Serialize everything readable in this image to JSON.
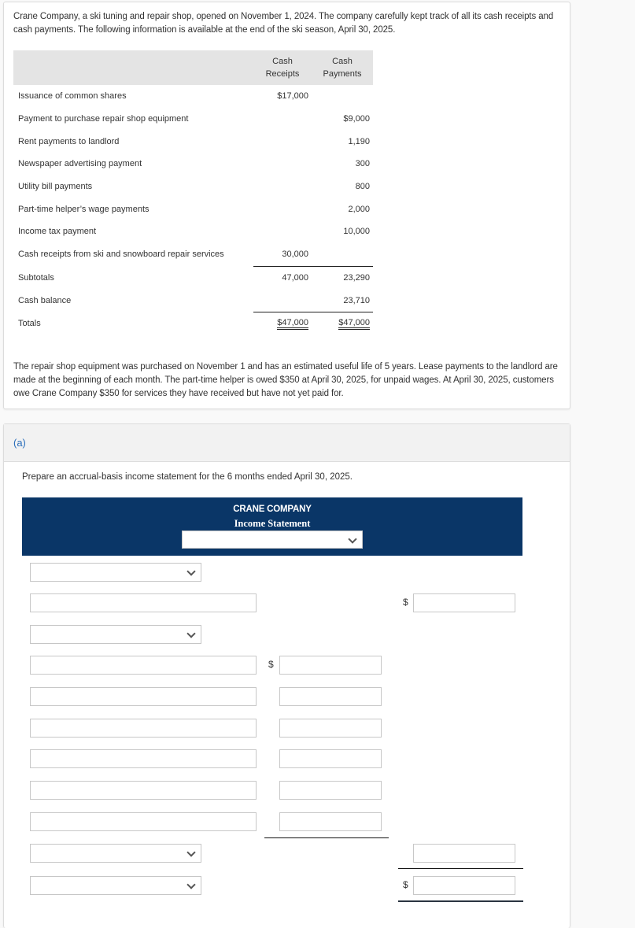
{
  "problem": {
    "intro": "Crane Company, a ski tuning and repair shop, opened on November 1, 2024. The company carefully kept track of all its cash receipts and cash payments. The following information is available at the end of the ski season, April 30, 2025.",
    "table": {
      "headers": [
        "",
        "Cash\nReceipts",
        "Cash\nPayments"
      ],
      "header_receipts_1": "Cash",
      "header_receipts_2": "Receipts",
      "header_payments_1": "Cash",
      "header_payments_2": "Payments",
      "rows": [
        {
          "label": "Issuance of common shares",
          "receipts": "$17,000",
          "payments": ""
        },
        {
          "label": "Payment to purchase repair shop equipment",
          "receipts": "",
          "payments": "$9,000"
        },
        {
          "label": "Rent payments to landlord",
          "receipts": "",
          "payments": "1,190"
        },
        {
          "label": "Newspaper advertising payment",
          "receipts": "",
          "payments": "300"
        },
        {
          "label": "Utility bill payments",
          "receipts": "",
          "payments": "800"
        },
        {
          "label": "Part-time helper’s wage payments",
          "receipts": "",
          "payments": "2,000"
        },
        {
          "label": "Income tax payment",
          "receipts": "",
          "payments": "10,000"
        },
        {
          "label": "Cash receipts from ski and snowboard repair services",
          "receipts": "30,000",
          "payments": ""
        },
        {
          "label": "Subtotals",
          "receipts": "47,000",
          "payments": "23,290"
        },
        {
          "label": "Cash balance",
          "receipts": "",
          "payments": "23,710"
        },
        {
          "label": "Totals",
          "receipts": "$47,000",
          "payments": "$47,000"
        }
      ]
    },
    "note": "The repair shop equipment was purchased on November 1 and has an estimated useful life of 5 years. Lease payments to the landlord are made at the beginning of each month. The part-time helper is owed $350 at April 30, 2025, for unpaid wages. At April 30, 2025, customers owe Crane Company $350 for services they have received but have not yet paid for."
  },
  "part_a": {
    "label": "(a)",
    "instruction": "Prepare an accrual-basis income statement for the 6 months ended April 30, 2025.",
    "statement": {
      "company": "CRANE COMPANY",
      "title": "Income Statement",
      "period_select": ""
    },
    "currency_symbol": "$",
    "form": {
      "revenue_select": "",
      "revenue_label": "",
      "revenue_amount": "",
      "expenses_select": "",
      "expense_lines": [
        {
          "label": "",
          "amount": ""
        },
        {
          "label": "",
          "amount": ""
        },
        {
          "label": "",
          "amount": ""
        },
        {
          "label": "",
          "amount": ""
        },
        {
          "label": "",
          "amount": ""
        },
        {
          "label": "",
          "amount": ""
        }
      ],
      "total_expenses_select": "",
      "total_expenses_amount": "",
      "net_income_select": "",
      "net_income_amount": ""
    }
  }
}
